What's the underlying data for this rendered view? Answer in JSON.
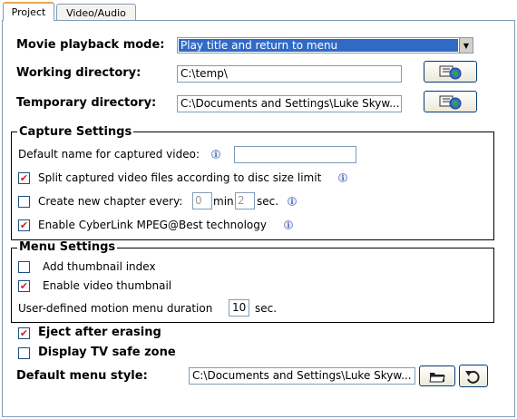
{
  "tabs": [
    {
      "label": "Project",
      "active": true
    },
    {
      "label": "Video/Audio",
      "active": false
    }
  ],
  "movie_playback": {
    "label": "Movie playback mode:",
    "value": "Play title and return to menu"
  },
  "working_directory": {
    "label": "Working directory:",
    "value": "C:\\temp\\"
  },
  "temporary_directory": {
    "label": "Temporary directory:",
    "value": "C:\\Documents and Settings\\Luke Skyw..."
  },
  "capture_settings": {
    "title": "Capture Settings",
    "default_name_label": "Default name for captured video:",
    "default_name_value": "",
    "split_label": "Split captured video files according to disc size limit",
    "split_checked": true,
    "chapter_label": "Create new chapter every:",
    "chapter_checked": false,
    "chapter_min": "0",
    "chapter_min_unit": "min.",
    "chapter_sec": "2",
    "chapter_sec_unit": "sec.",
    "mpeg_label": "Enable CyberLink MPEG@Best technology",
    "mpeg_checked": true
  },
  "menu_settings": {
    "title": "Menu Settings",
    "thumbnail_index_label": "Add thumbnail index",
    "thumbnail_index_checked": false,
    "video_thumbnail_label": "Enable video thumbnail",
    "video_thumbnail_checked": true,
    "motion_label": "User-defined motion menu duration",
    "motion_value": "10",
    "motion_unit": "sec."
  },
  "eject": {
    "label": "Eject after erasing",
    "checked": true
  },
  "tv_safe": {
    "label": "Display TV safe zone",
    "checked": false
  },
  "default_menu_style": {
    "label": "Default menu style:",
    "value": "C:\\Documents and Settings\\Luke Skyw..."
  },
  "check_mark": "✔",
  "info_glyph": "i",
  "colors": {
    "selection": "#316ac5",
    "check": "#d42020",
    "tab_highlight": "#e6a84b"
  }
}
